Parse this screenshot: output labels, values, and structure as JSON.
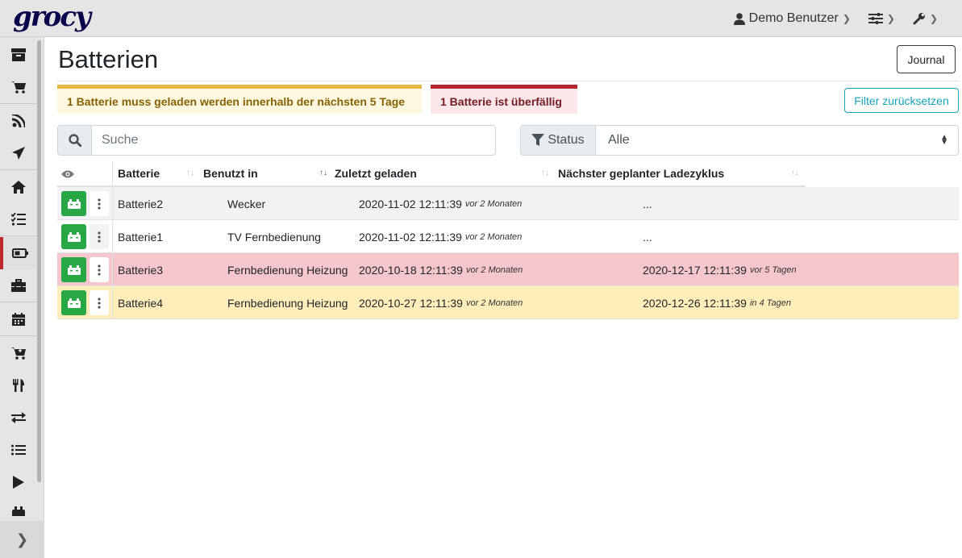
{
  "app": {
    "logo": "grocy"
  },
  "topnav": {
    "user": "Demo Benutzer"
  },
  "page": {
    "title": "Batterien",
    "journal_label": "Journal"
  },
  "alerts": {
    "due_soon": "1 Batterie muss geladen werden innerhalb der nächsten 5 Tage",
    "overdue": "1 Batterie ist überfällig"
  },
  "filters": {
    "reset_label": "Filter zurücksetzen",
    "search_placeholder": "Suche",
    "status_label": "Status",
    "status_value": "Alle"
  },
  "table": {
    "headers": {
      "battery": "Batterie",
      "used_in": "Benutzt in",
      "last_charged": "Zuletzt geladen",
      "next_charge": "Nächster geplanter Ladezyklus"
    },
    "rows": [
      {
        "name": "Batterie2",
        "used_in": "Wecker",
        "last": "2020-11-02 12:11:39",
        "last_rel": "vor 2 Monaten",
        "next": "...",
        "next_rel": ""
      },
      {
        "name": "Batterie1",
        "used_in": "TV Fernbedienung",
        "last": "2020-11-02 12:11:39",
        "last_rel": "vor 2 Monaten",
        "next": "...",
        "next_rel": ""
      },
      {
        "name": "Batterie3",
        "used_in": "Fernbedienung Heizung",
        "last": "2020-10-18 12:11:39",
        "last_rel": "vor 2 Monaten",
        "next": "2020-12-17 12:11:39",
        "next_rel": "vor 5 Tagen"
      },
      {
        "name": "Batterie4",
        "used_in": "Fernbedienung Heizung",
        "last": "2020-10-27 12:11:39",
        "last_rel": "vor 2 Monaten",
        "next": "2020-12-26 12:11:39",
        "next_rel": "in 4 Tagen"
      }
    ]
  },
  "colors": {
    "accent_green": "#28a745",
    "info": "#17a2b8",
    "warning_bar": "#e4b944",
    "danger_bar": "#b3272d",
    "row_overdue": "#f5c6cb",
    "row_due_soon": "#ffeeba"
  },
  "sidebar": {
    "icons": [
      "box-icon",
      "cart-icon",
      "rss-icon",
      "plane-icon",
      "home-icon",
      "tasks-icon",
      "battery-icon",
      "toolbox-icon",
      "calendar-icon",
      "cart-plus-icon",
      "utensils-icon",
      "exchange-icon",
      "list-icon",
      "play-icon",
      "more-icon"
    ]
  }
}
